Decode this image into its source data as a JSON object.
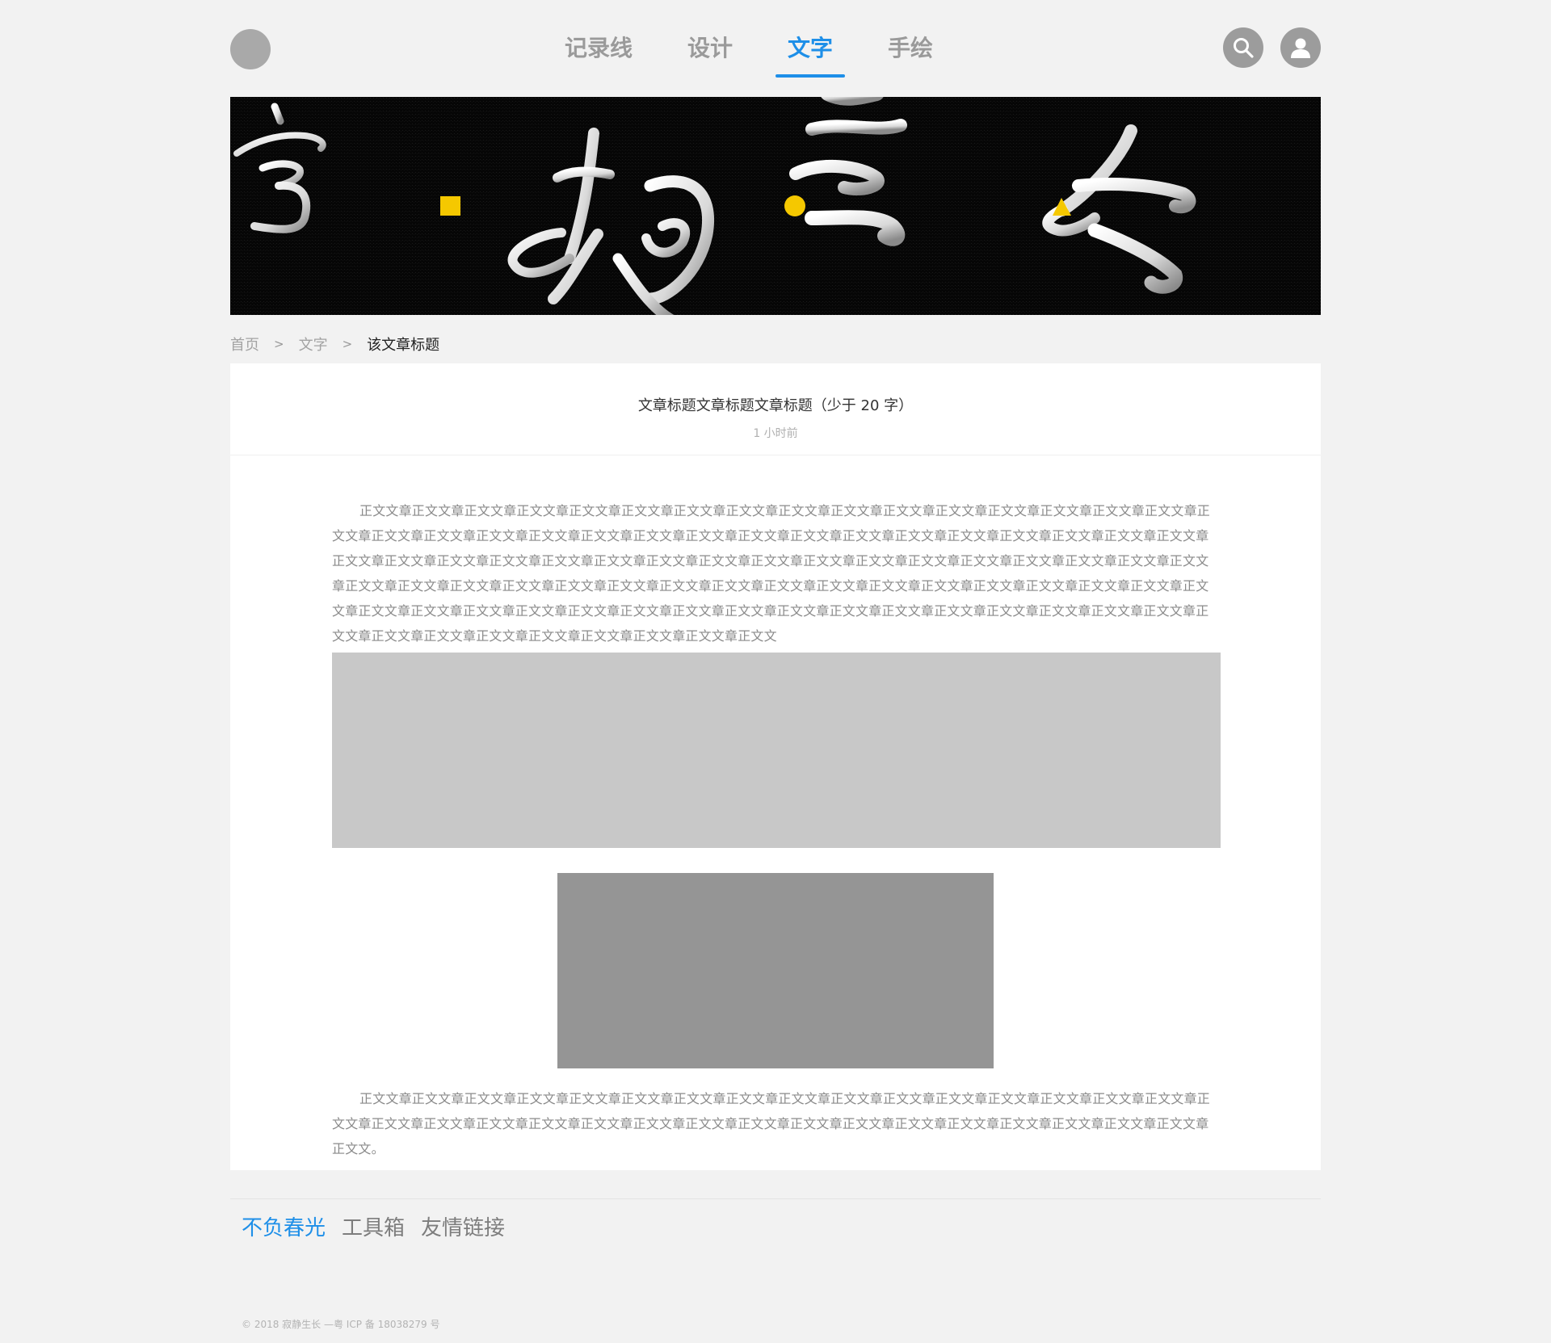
{
  "nav": {
    "items": [
      {
        "label": "记录线",
        "active": false
      },
      {
        "label": "设计",
        "active": false
      },
      {
        "label": "文字",
        "active": true
      },
      {
        "label": "手绘",
        "active": false
      }
    ]
  },
  "icons": {
    "logo": "logo-circle",
    "search": "search-icon",
    "user": "user-icon"
  },
  "colors": {
    "accent": "#1e8fe8",
    "banner_dot": "#f5c800",
    "background": "#f2f2f2"
  },
  "breadcrumb": {
    "home": "首页",
    "separator": ">",
    "section": "文字",
    "current": "该文章标题"
  },
  "article": {
    "title": "文章标题文章标题文章标题（少于 20 字）",
    "time": "1 小时前",
    "paragraph1": "正文文章正文文章正文文章正文文章正文文章正文文章正文文章正文文章正文文章正文文章正文文章正文文章正文文章正文文章正文文章正文文章正文文章正文文章正文文章正文文章正文文章正文文章正文文章正文文章正文文章正文文章正文文章正文文章正文文章正文文章正文文章正文文章正文文章正文文章正文文章正文文章正文文章正文文章正文文章正文文章正文文章正文文章正文文章正文文章正文文章正文文章正文文章正文文章正文文章正文文章正文文章正文文章正文文章正文文章正文文章正文文章正文文章正文文章正文文章正文文章正文文章正文文章正文文章正文文章正文文章正文文章正文文章正文文章正文文章正文文章正文文章正文文章正文文章正文文章正文文章正文文章正文文章正文文章正文文章正文文章正文文章正文文章正文文章正文文章正文文章正文文章正文文章正文文章正文文章正文文章正文文章正文文",
    "paragraph2": "正文文章正文文章正文文章正文文章正文文章正文文章正文文章正文文章正文文章正文文章正文文章正文文章正文文章正文文章正文文章正文文章正文文章正文文章正文文章正文文章正文文章正文文章正文文章正文文章正文文章正文文章正文文章正文文章正文文章正文文章正文文章正文文章正文文章正文文。"
  },
  "footer": {
    "links": [
      {
        "label": "不负春光",
        "active": true
      },
      {
        "label": "工具箱",
        "active": false
      },
      {
        "label": "友情链接",
        "active": false
      }
    ],
    "copyright": "© 2018 寂静生长 —粤 ICP 备 18038279 号"
  }
}
